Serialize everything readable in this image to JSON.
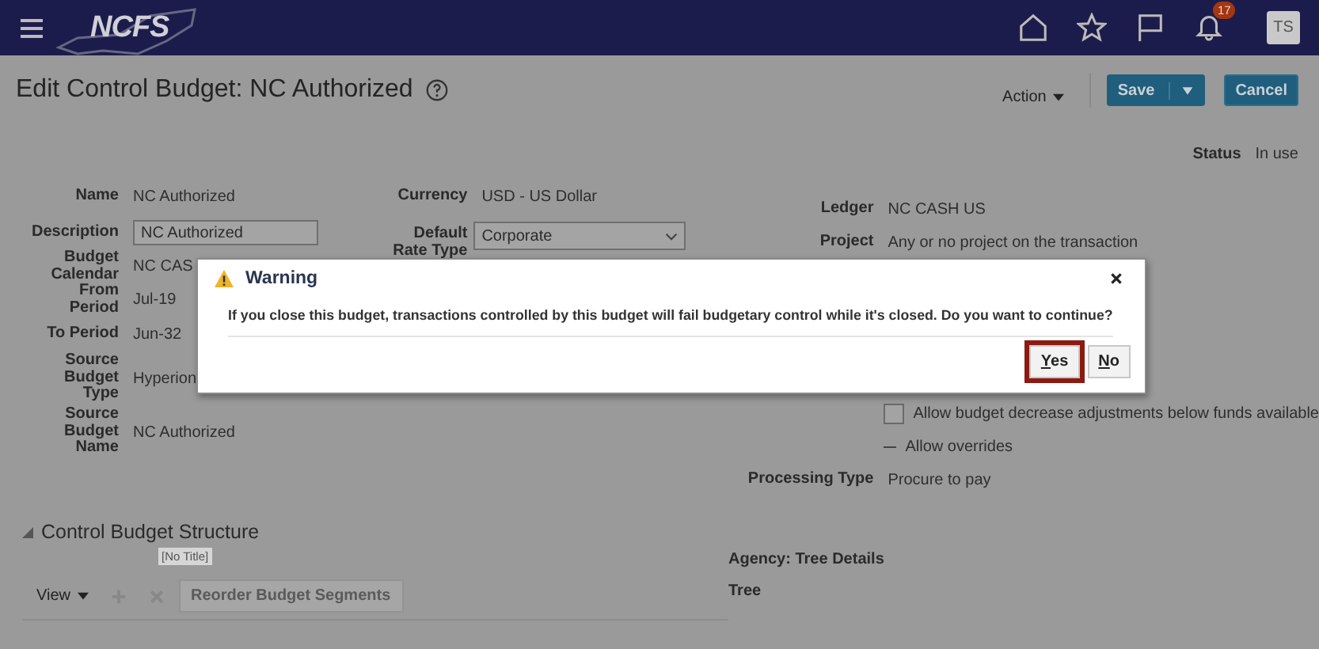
{
  "header": {
    "logo_text": "NCFS",
    "notification_count": "17",
    "avatar_initials": "TS"
  },
  "page": {
    "title": "Edit Control Budget: NC Authorized",
    "action_menu": "Action",
    "buttons": [
      {
        "label": "Save",
        "kind": "split"
      },
      {
        "label": "Cancel",
        "kind": "plain"
      }
    ],
    "status": {
      "label": "Status",
      "value": "In use"
    }
  },
  "form": {
    "left": [
      {
        "label": "Name",
        "value": "NC Authorized",
        "kind": "text"
      },
      {
        "label": "Description",
        "value": "NC Authorized",
        "kind": "input"
      },
      {
        "label": "Budget Calendar",
        "value": "NC CAS",
        "kind": "text"
      },
      {
        "label": "From Period",
        "value": "Jul-19",
        "kind": "text"
      },
      {
        "label": "To Period",
        "value": "Jun-32",
        "kind": "text"
      },
      {
        "label": "Source Budget Type",
        "value": "Hyperion",
        "kind": "text"
      },
      {
        "label": "Source Budget Name",
        "value": "NC Authorized",
        "kind": "text"
      }
    ],
    "middle": [
      {
        "label": "Currency",
        "value": "USD - US Dollar",
        "kind": "text"
      },
      {
        "label": "Default Rate Type",
        "value": "Corporate",
        "kind": "select"
      }
    ],
    "right": [
      {
        "label": "Ledger",
        "value": "NC CASH US",
        "kind": "text"
      },
      {
        "label": "Project",
        "value": "Any or no project on the transaction",
        "kind": "text"
      }
    ],
    "checkbox": {
      "label": "Allow budget decrease adjustments below funds available",
      "checked": false
    },
    "overrides": {
      "label": "Allow overrides"
    },
    "processing": {
      "label": "Processing Type",
      "value": "Procure to pay"
    }
  },
  "section": {
    "title": "Control Budget Structure",
    "expanded": true,
    "no_title": "[No Title]",
    "view_menu": "View",
    "reorder_button": {
      "label": "Reorder Budget Segments",
      "disabled": true
    },
    "tree_details_title": "Agency: Tree Details",
    "tree_label": "Tree"
  },
  "dialog": {
    "title": "Warning",
    "message": "If you close this budget, transactions controlled by this budget will fail budgetary control while it's closed. Do you want to continue?",
    "buttons": [
      {
        "label": "Yes",
        "highlighted": true
      },
      {
        "label": "No",
        "highlighted": false
      }
    ]
  }
}
